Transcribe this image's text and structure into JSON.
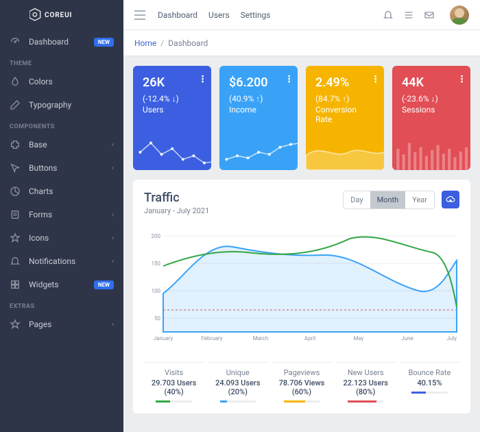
{
  "brand": "COREUI",
  "topbar": {
    "links": [
      "Dashboard",
      "Users",
      "Settings"
    ]
  },
  "breadcrumb": {
    "home": "Home",
    "current": "Dashboard"
  },
  "sidebar": {
    "dashboard": {
      "label": "Dashboard",
      "badge": "NEW"
    },
    "sections": {
      "theme": {
        "title": "THEME",
        "items": [
          {
            "label": "Colors"
          },
          {
            "label": "Typography"
          }
        ]
      },
      "components": {
        "title": "COMPONENTS",
        "items": [
          {
            "label": "Base"
          },
          {
            "label": "Buttons"
          },
          {
            "label": "Charts"
          },
          {
            "label": "Forms"
          },
          {
            "label": "Icons"
          },
          {
            "label": "Notifications"
          },
          {
            "label": "Widgets",
            "badge": "NEW"
          }
        ]
      },
      "extras": {
        "title": "EXTRAS",
        "items": [
          {
            "label": "Pages"
          }
        ]
      }
    }
  },
  "cards": [
    {
      "value": "26K",
      "pct": "(-12.4% ↓)",
      "label": "Users",
      "color": "c-blue"
    },
    {
      "value": "$6.200",
      "pct": "(40.9% ↑)",
      "label": "Income",
      "color": "c-lblue"
    },
    {
      "value": "2.49%",
      "pct": "(84.7% ↑)",
      "label": "Conversion Rate",
      "color": "c-yellow"
    },
    {
      "value": "44K",
      "pct": "(-23.6% ↓)",
      "label": "Sessions",
      "color": "c-red"
    }
  ],
  "traffic": {
    "title": "Traffic",
    "subtitle": "January - July 2021",
    "range": {
      "options": [
        "Day",
        "Month",
        "Year"
      ],
      "active": "Month"
    },
    "stats": [
      {
        "name": "Visits",
        "value": "29.703 Users (40%)",
        "pct": 40,
        "color": "#31a745"
      },
      {
        "name": "Unique",
        "value": "24.093 Users (20%)",
        "pct": 20,
        "color": "#39a2f7"
      },
      {
        "name": "Pageviews",
        "value": "78.706 Views (60%)",
        "pct": 60,
        "color": "#f6b400"
      },
      {
        "name": "New Users",
        "value": "22.123 Users (80%)",
        "pct": 80,
        "color": "#e14e55"
      },
      {
        "name": "Bounce Rate",
        "value": "40.15%",
        "pct": 40,
        "color": "#3b5fe0"
      }
    ]
  },
  "chart_data": {
    "type": "line",
    "categories": [
      "January",
      "February",
      "March",
      "April",
      "May",
      "June",
      "July"
    ],
    "series": [
      {
        "name": "green",
        "values": [
          145,
          175,
          168,
          165,
          195,
          172,
          70
        ],
        "color": "#31a745"
      },
      {
        "name": "blue_area",
        "values": [
          95,
          180,
          148,
          155,
          120,
          100,
          155
        ],
        "color": "#39a2f7"
      },
      {
        "name": "red_dashed",
        "values": [
          65,
          65,
          65,
          65,
          65,
          65,
          65
        ],
        "color": "#e14e55"
      }
    ],
    "yticks": [
      50,
      100,
      150,
      200
    ],
    "ylim": [
      40,
      210
    ],
    "xlabel": "",
    "ylabel": "",
    "title": "Traffic"
  }
}
